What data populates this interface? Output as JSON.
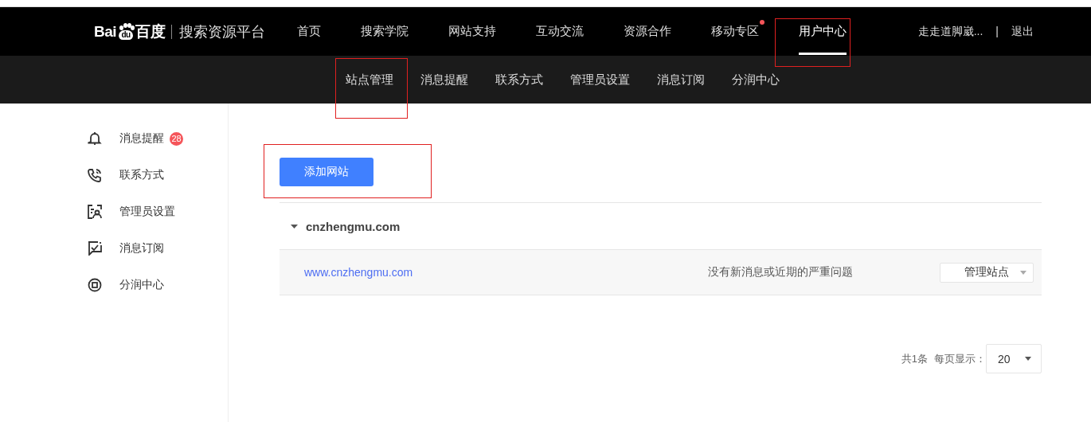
{
  "header": {
    "logo": {
      "latin": "Bai",
      "paw": "du",
      "chinese": "百度"
    },
    "platform": "搜索资源平台",
    "nav": [
      {
        "label": "首页",
        "selected": false,
        "dot": false
      },
      {
        "label": "搜索学院",
        "selected": false,
        "dot": false
      },
      {
        "label": "网站支持",
        "selected": false,
        "dot": false
      },
      {
        "label": "互动交流",
        "selected": false,
        "dot": false
      },
      {
        "label": "资源合作",
        "selected": false,
        "dot": false
      },
      {
        "label": "移动专区",
        "selected": false,
        "dot": true
      },
      {
        "label": "用户中心",
        "selected": true,
        "dot": false
      }
    ],
    "user": "走走道脚崴...",
    "separator": "|",
    "logout": "退出"
  },
  "subnav": [
    {
      "label": "站点管理"
    },
    {
      "label": "消息提醒"
    },
    {
      "label": "联系方式"
    },
    {
      "label": "管理员设置"
    },
    {
      "label": "消息订阅"
    },
    {
      "label": "分润中心"
    }
  ],
  "sidebar": {
    "items": [
      {
        "label": "消息提醒",
        "selected": false,
        "badge": "28"
      },
      {
        "label": "联系方式",
        "selected": false
      },
      {
        "label": "管理员设置",
        "selected": false
      },
      {
        "label": "消息订阅",
        "selected": false
      },
      {
        "label": "分润中心",
        "selected": false
      }
    ]
  },
  "main": {
    "add_button": "添加网站",
    "groups": [
      {
        "domain": "cnzhengmu.com",
        "expanded": true,
        "sites": [
          {
            "url": "www.cnzhengmu.com",
            "status": "没有新消息或近期的严重问题",
            "action": "管理站点"
          }
        ]
      }
    ],
    "pagination": {
      "total": "共1条",
      "per_page_label": "每页显示：",
      "per_page": "20"
    }
  }
}
